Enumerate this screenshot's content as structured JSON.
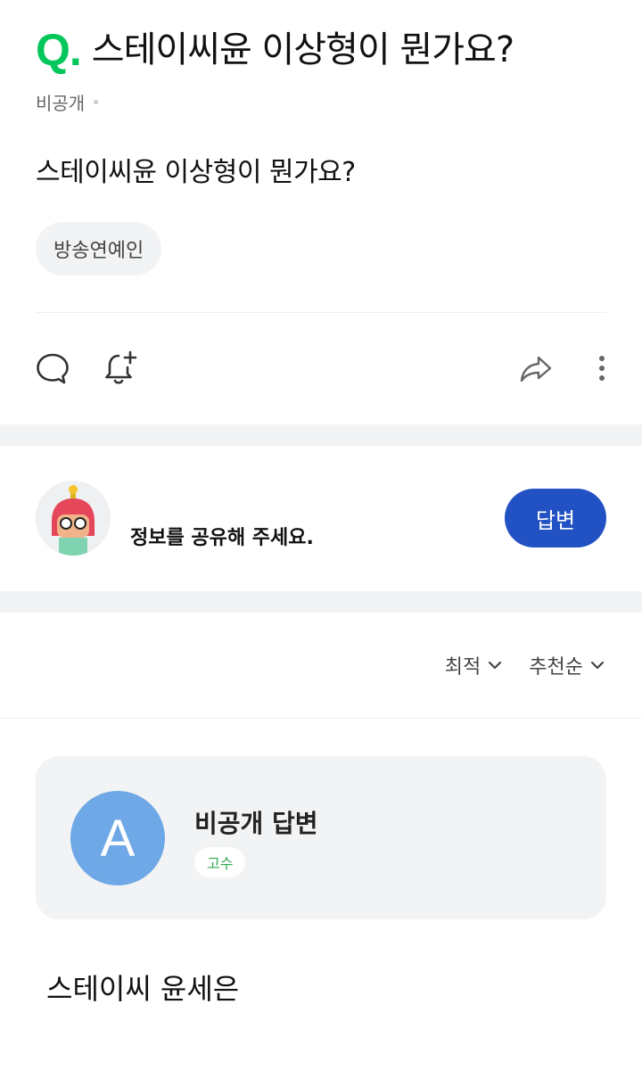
{
  "question": {
    "mark": "Q.",
    "title": "스테이씨윤 이상형이 뭔가요?",
    "author": "비공개",
    "body": "스테이씨윤 이상형이 뭔가요?",
    "tag": "방송연예인"
  },
  "actions": {
    "comment": "comment-icon",
    "notify": "bell-plus-icon",
    "share": "share-icon",
    "more": "more-vertical-icon"
  },
  "promo": {
    "message": "정보를 공유해 주세요.",
    "answer_button": "답변"
  },
  "sort": {
    "option1": "최적",
    "option2": "추천순"
  },
  "answer": {
    "avatar_letter": "A",
    "author": "비공개 답변",
    "badge": "고수",
    "text": "스테이씨 윤세은"
  },
  "colors": {
    "brand_green": "#03c75a",
    "button_blue": "#2251c4",
    "avatar_blue": "#6fa8e6",
    "badge_green": "#2fa94e"
  }
}
